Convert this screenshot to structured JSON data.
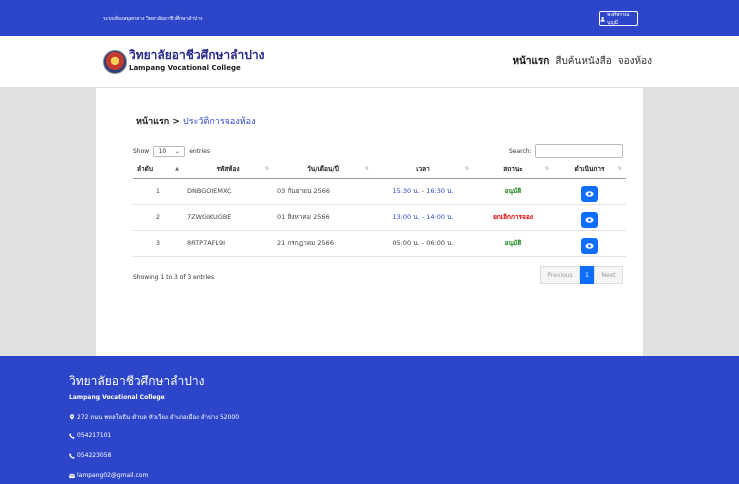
{
  "topbar": {
    "system_name": "ระบบห้องสมุดกลาง วิทยาลัยอาชีวศึกษาลำปาง",
    "user_label": "พงศ์พรรณ บุญมี"
  },
  "header": {
    "brand_th": "วิทยาลัยอาชีวศึกษาลำปาง",
    "brand_en": "Lampang Vocational College"
  },
  "nav": {
    "items": [
      "หน้าแรก",
      "สืบค้นหนังสือ",
      "จองห้อง"
    ]
  },
  "breadcrumb": {
    "home": "หน้าแรก",
    "separator": " > ",
    "current": "ประวัติการจองห้อง"
  },
  "table_controls": {
    "show_label": "Show",
    "page_length": "10",
    "entries_label": "entries",
    "search_label": "Search:"
  },
  "table": {
    "headers": [
      "ลำดับ",
      "รหัสห้อง",
      "วัน/เดือน/ปี",
      "เวลา",
      "สถานะ",
      "ดำเนินการ"
    ],
    "rows": [
      {
        "no": "1",
        "code": "DNBGOIEMXC",
        "date": "03 กันยายน 2566",
        "time": "15:30 น. - 16:30 น.",
        "status": "อนุมัติ",
        "status_type": "approved"
      },
      {
        "no": "2",
        "code": "7ZWGIKUGBE",
        "date": "01 สิงหาคม 2566",
        "time": "13:00 น. - 14:00 น.",
        "status": "ยกเลิกการจอง",
        "status_type": "cancelled"
      },
      {
        "no": "3",
        "code": "8RTP7AFL9I",
        "date": "21 กรกฎาคม 2566",
        "time": "05:00 น. - 06:00 น.",
        "status": "อนุมัติ",
        "status_type": "approved"
      }
    ]
  },
  "table_info": "Showing 1 to 3 of 3 entries",
  "pagination": {
    "previous": "Previous",
    "current": "1",
    "next": "Next"
  },
  "footer": {
    "title": "วิทยาลัยอาชีวศึกษาลำปาง",
    "subtitle": "Lampang Vocational College",
    "address": "272 ถนน พหลโยธิน ตำบล หัวเวียง อำเภอเมือง ลำปาง 52000",
    "phone1": "054217101",
    "phone2": "054223058",
    "email": "lampang02@gmail.com"
  },
  "colors": {
    "primary": "#2d46c9",
    "action_button": "#0d6efd",
    "approved": "#1f8a1f",
    "cancelled": "#dd0000"
  }
}
